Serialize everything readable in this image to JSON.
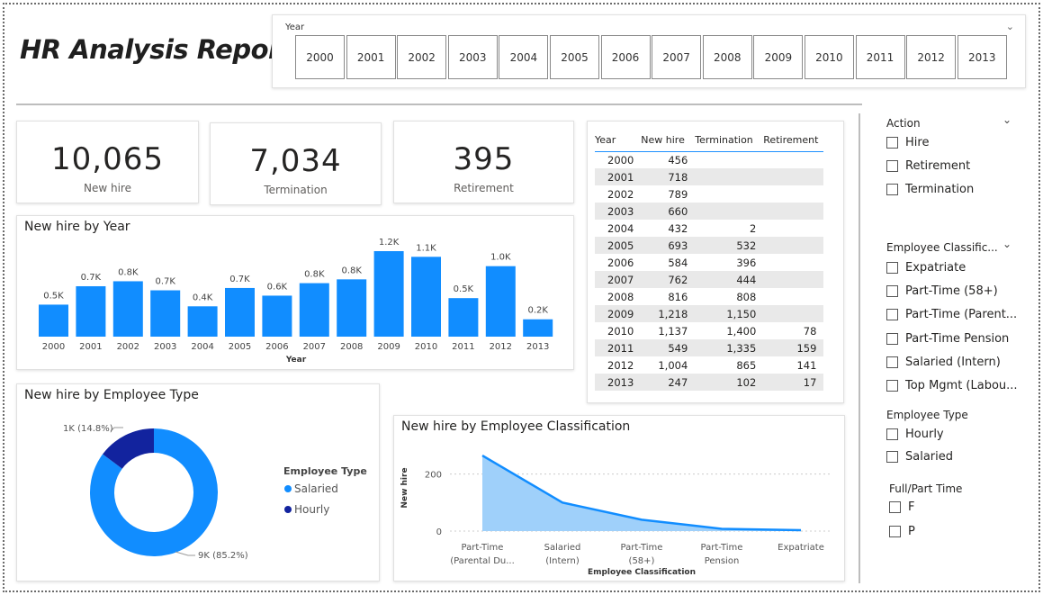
{
  "report_title": "HR Analysis Report",
  "year_slicer": {
    "label": "Year",
    "years": [
      "2000",
      "2001",
      "2002",
      "2003",
      "2004",
      "2005",
      "2006",
      "2007",
      "2008",
      "2009",
      "2010",
      "2011",
      "2012",
      "2013"
    ]
  },
  "kpis": [
    {
      "value": "10,065",
      "caption": "New hire"
    },
    {
      "value": "7,034",
      "caption": "Termination"
    },
    {
      "value": "395",
      "caption": "Retirement"
    }
  ],
  "colors": {
    "accent": "#118DFF",
    "dark_blue": "#12239E",
    "area_fill": "#9fd0fa"
  },
  "table": {
    "headers": [
      "Year",
      "New hire",
      "Termination",
      "Retirement"
    ],
    "rows": [
      [
        "2000",
        "456",
        "",
        ""
      ],
      [
        "2001",
        "718",
        "",
        ""
      ],
      [
        "2002",
        "789",
        "",
        ""
      ],
      [
        "2003",
        "660",
        "",
        ""
      ],
      [
        "2004",
        "432",
        "2",
        ""
      ],
      [
        "2005",
        "693",
        "532",
        ""
      ],
      [
        "2006",
        "584",
        "396",
        ""
      ],
      [
        "2007",
        "762",
        "444",
        ""
      ],
      [
        "2008",
        "816",
        "808",
        ""
      ],
      [
        "2009",
        "1,218",
        "1,150",
        ""
      ],
      [
        "2010",
        "1,137",
        "1,400",
        "78"
      ],
      [
        "2011",
        "549",
        "1,335",
        "159"
      ],
      [
        "2012",
        "1,004",
        "865",
        "141"
      ],
      [
        "2013",
        "247",
        "102",
        "17"
      ]
    ]
  },
  "filters": {
    "action": {
      "title": "Action",
      "items": [
        "Hire",
        "Retirement",
        "Termination"
      ]
    },
    "classification": {
      "title": "Employee Classific...",
      "items": [
        "Expatriate",
        "Part-Time (58+)",
        "Part-Time (Parent...",
        "Part-Time Pension",
        "Salaried (Intern)",
        "Top Mgmt (Labou..."
      ]
    },
    "employee_type": {
      "title": "Employee Type",
      "items": [
        "Hourly",
        "Salaried"
      ]
    },
    "full_part": {
      "title": "Full/Part Time",
      "items": [
        "F",
        "P"
      ]
    }
  },
  "chart_data": [
    {
      "type": "bar",
      "title": "New hire by Year",
      "xlabel": "Year",
      "ylabel": "",
      "categories": [
        "2000",
        "2001",
        "2002",
        "2003",
        "2004",
        "2005",
        "2006",
        "2007",
        "2008",
        "2009",
        "2010",
        "2011",
        "2012",
        "2013"
      ],
      "values": [
        456,
        718,
        789,
        660,
        432,
        693,
        584,
        762,
        816,
        1218,
        1137,
        549,
        1004,
        247
      ],
      "data_labels": [
        "0.5K",
        "0.7K",
        "0.8K",
        "0.7K",
        "0.4K",
        "0.7K",
        "0.6K",
        "0.8K",
        "0.8K",
        "1.2K",
        "1.1K",
        "0.5K",
        "1.0K",
        "0.2K"
      ],
      "ylim": [
        0,
        1300
      ]
    },
    {
      "type": "pie",
      "title": "New hire by Employee Type",
      "legend_title": "Employee Type",
      "legend_position": "right",
      "slices": [
        {
          "name": "Salaried",
          "value": 85.2,
          "label": "9K (85.2%)"
        },
        {
          "name": "Hourly",
          "value": 14.8,
          "label": "1K (14.8%)"
        }
      ]
    },
    {
      "type": "area",
      "title": "New hire by Employee Classification",
      "xlabel": "Employee Classification",
      "ylabel": "New hire",
      "categories": [
        "Part-Time (Parental Du...",
        "Salaried (Intern)",
        "Part-Time (58+)",
        "Part-Time Pension",
        "Expatriate"
      ],
      "category_lines": [
        [
          "Part-Time",
          "(Parental Du..."
        ],
        [
          "Salaried",
          "(Intern)"
        ],
        [
          "Part-Time",
          "(58+)"
        ],
        [
          "Part-Time",
          "Pension"
        ],
        [
          "Expatriate"
        ]
      ],
      "values": [
        265,
        100,
        40,
        8,
        3
      ],
      "yticks": [
        "0",
        "200"
      ],
      "ylim": [
        0,
        300
      ]
    }
  ]
}
